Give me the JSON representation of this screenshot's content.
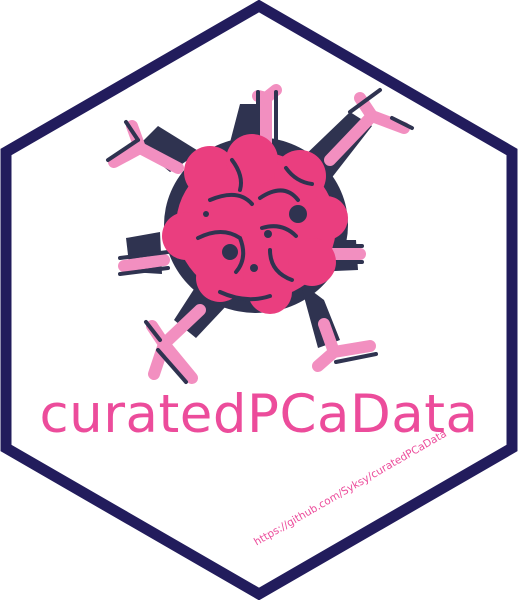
{
  "sticker": {
    "title": "curatedPCaData",
    "url": "https://github.com/Syksy/curatedPCaData",
    "icon": "tumor-cell-icon"
  },
  "colors": {
    "border": "#221c5c",
    "background": "#ffffff",
    "text": "#ec4c9b",
    "cell": "#ea3e7f",
    "cell_detail": "#2f3350",
    "branch": "#f28fc0"
  }
}
